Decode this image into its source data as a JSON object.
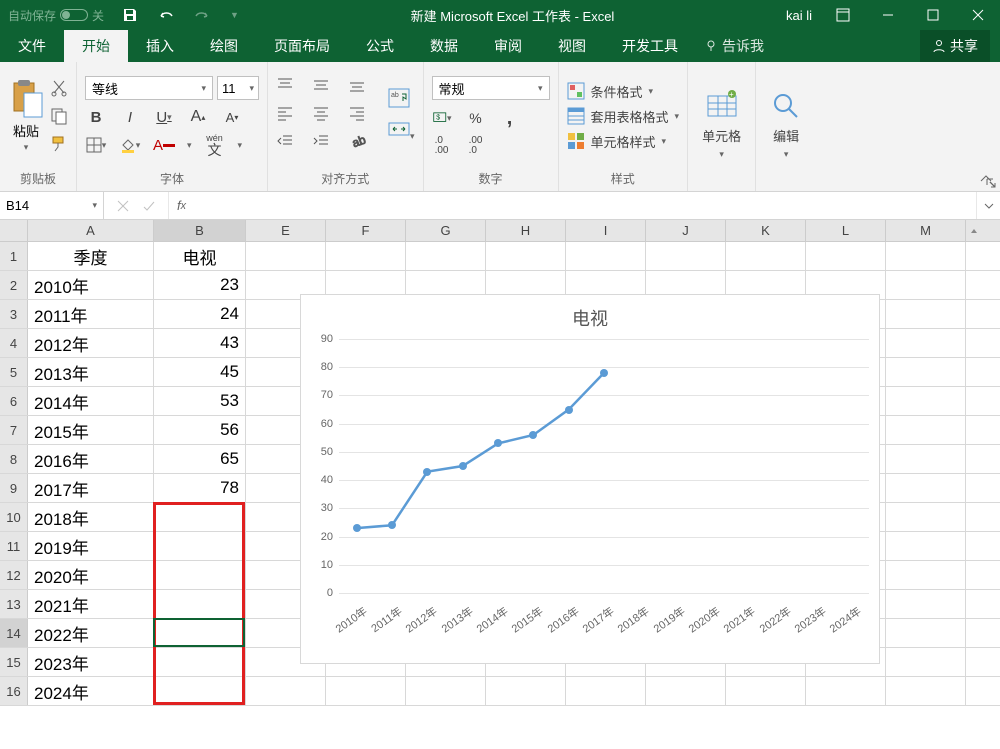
{
  "title_bar": {
    "autosave": "自动保存",
    "autosave_state": "关",
    "doc_title": "新建 Microsoft Excel 工作表 - Excel",
    "user": "kai li"
  },
  "tabs": {
    "file": "文件",
    "home": "开始",
    "insert": "插入",
    "draw": "绘图",
    "layout": "页面布局",
    "formulas": "公式",
    "data": "数据",
    "review": "审阅",
    "view": "视图",
    "developer": "开发工具",
    "tell_me": "告诉我",
    "share": "共享"
  },
  "ribbon": {
    "clipboard": {
      "paste": "粘贴",
      "label": "剪贴板"
    },
    "font": {
      "name": "等线",
      "size": "11",
      "label": "字体",
      "wen": "wén",
      "wen2": "文"
    },
    "align": {
      "label": "对齐方式"
    },
    "number": {
      "format": "常规",
      "label": "数字"
    },
    "styles": {
      "cond": "条件格式",
      "table": "套用表格格式",
      "cell": "单元格样式",
      "label": "样式"
    },
    "cells": {
      "label": "单元格"
    },
    "editing": {
      "label": "编辑"
    }
  },
  "name_box": "B14",
  "columns": [
    "A",
    "B",
    "E",
    "F",
    "G",
    "H",
    "I",
    "J",
    "K",
    "L",
    "M"
  ],
  "headers": {
    "A": "季度",
    "B": "电视"
  },
  "table_rows": [
    {
      "r": 2,
      "a": "2010年",
      "b": "23"
    },
    {
      "r": 3,
      "a": "2011年",
      "b": "24"
    },
    {
      "r": 4,
      "a": "2012年",
      "b": "43"
    },
    {
      "r": 5,
      "a": "2013年",
      "b": "45"
    },
    {
      "r": 6,
      "a": "2014年",
      "b": "53"
    },
    {
      "r": 7,
      "a": "2015年",
      "b": "56"
    },
    {
      "r": 8,
      "a": "2016年",
      "b": "65"
    },
    {
      "r": 9,
      "a": "2017年",
      "b": "78"
    },
    {
      "r": 10,
      "a": "2018年",
      "b": ""
    },
    {
      "r": 11,
      "a": "2019年",
      "b": ""
    },
    {
      "r": 12,
      "a": "2020年",
      "b": ""
    },
    {
      "r": 13,
      "a": "2021年",
      "b": ""
    },
    {
      "r": 14,
      "a": "2022年",
      "b": ""
    },
    {
      "r": 15,
      "a": "2023年",
      "b": ""
    },
    {
      "r": 16,
      "a": "2024年",
      "b": ""
    }
  ],
  "chart_data": {
    "type": "line",
    "title": "电视",
    "ylim": [
      0,
      90
    ],
    "yticks": [
      0,
      10,
      20,
      30,
      40,
      50,
      60,
      70,
      80,
      90
    ],
    "categories": [
      "2010年",
      "2011年",
      "2012年",
      "2013年",
      "2014年",
      "2015年",
      "2016年",
      "2017年",
      "2018年",
      "2019年",
      "2020年",
      "2021年",
      "2022年",
      "2023年",
      "2024年"
    ],
    "values": [
      23,
      24,
      43,
      45,
      53,
      56,
      65,
      78,
      null,
      null,
      null,
      null,
      null,
      null,
      null
    ],
    "series_color": "#5b9bd5"
  }
}
